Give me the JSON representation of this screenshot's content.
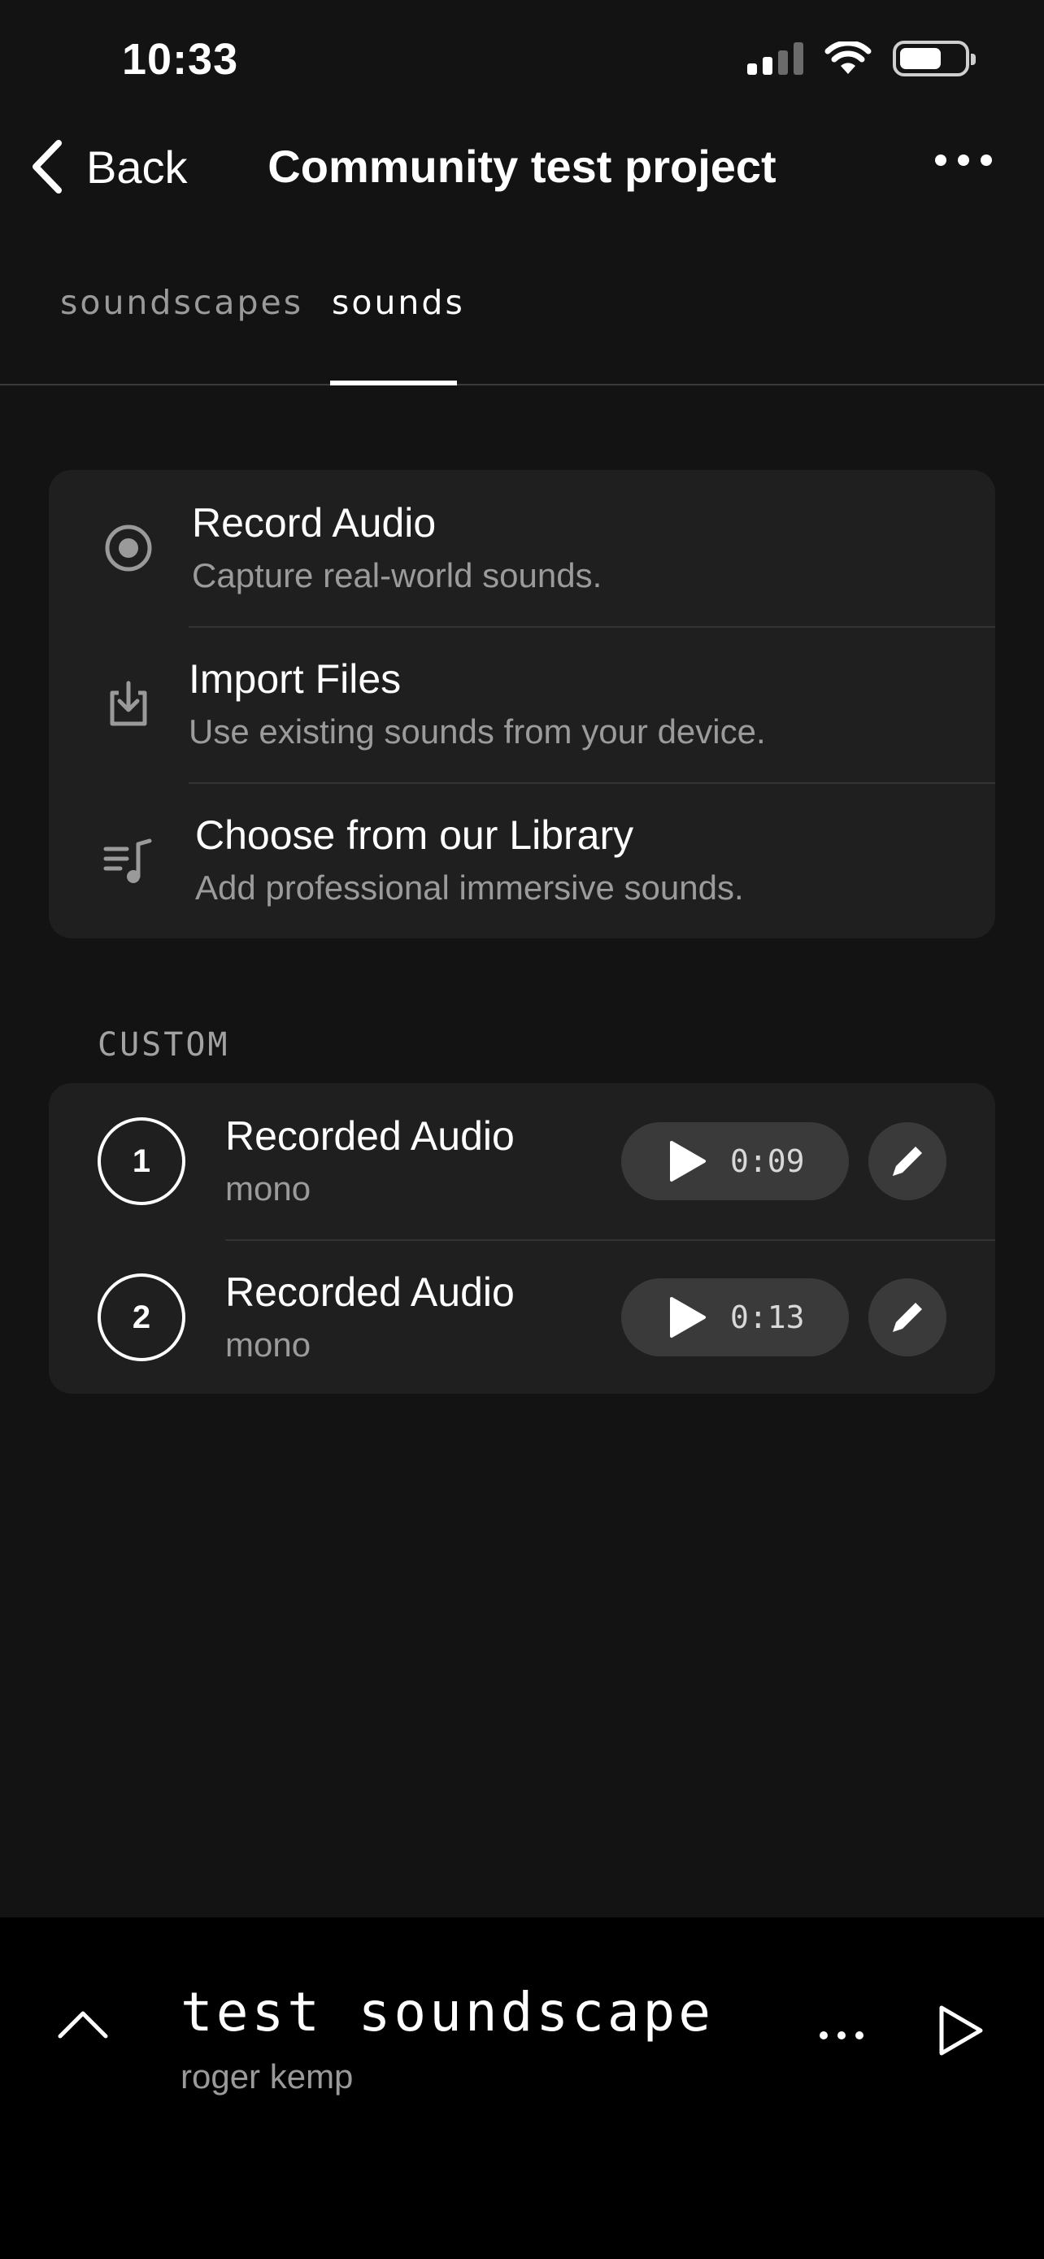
{
  "status_bar": {
    "time": "10:33"
  },
  "nav": {
    "back_label": "Back",
    "title": "Community test project"
  },
  "tabs": [
    {
      "label": "soundscapes",
      "active": false
    },
    {
      "label": "sounds",
      "active": true
    }
  ],
  "actions": [
    {
      "icon": "record-icon",
      "title": "Record Audio",
      "subtitle": "Capture real-world sounds."
    },
    {
      "icon": "import-icon",
      "title": "Import Files",
      "subtitle": "Use existing sounds from your device."
    },
    {
      "icon": "music-library-icon",
      "title": "Choose from our Library",
      "subtitle": "Add professional immersive sounds."
    }
  ],
  "custom": {
    "section_label": "CUSTOM",
    "sounds": [
      {
        "number": "1",
        "title": "Recorded Audio",
        "subtitle": "mono",
        "duration": "0:09"
      },
      {
        "number": "2",
        "title": "Recorded Audio",
        "subtitle": "mono",
        "duration": "0:13"
      }
    ]
  },
  "player": {
    "title": "test soundscape",
    "artist": "roger kemp"
  },
  "colors": {
    "background": "#131313",
    "card": "#1f1f1f",
    "pill": "#3a3a3a",
    "secondary_text": "#9b9b9b",
    "player_bg": "#000000"
  }
}
